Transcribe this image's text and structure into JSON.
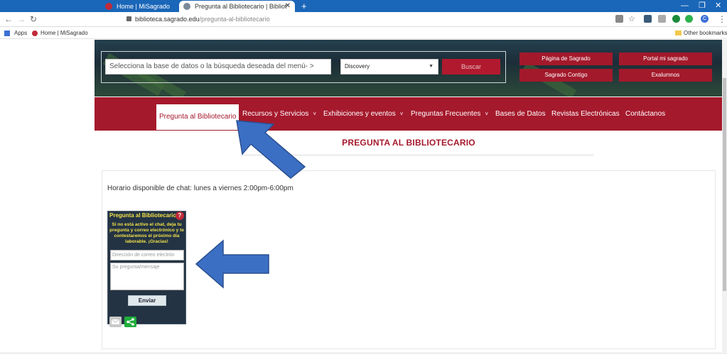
{
  "browser": {
    "tabs": [
      {
        "title": "Home | MiSagrado",
        "active": false
      },
      {
        "title": "Pregunta al Bibliotecario | Bibliot",
        "active": true
      }
    ],
    "new_tab_label": "+",
    "url_host": "biblioteca.sagrado.edu",
    "url_path": "/pregunta-al-bibliotecario",
    "bookmarks": {
      "apps_label": "Apps",
      "home_label": "Home | MiSagrado",
      "other_label": "Other bookmarks"
    },
    "profile_initial": "C"
  },
  "search": {
    "input_placeholder": "Selecciona la base de datos o la búsqueda deseada  del menú- >",
    "select_value": "Discovery",
    "button_label": "Buscar"
  },
  "quick_links": [
    "Página de Sagrado",
    "Portal mi sagrado",
    "Sagrado Contigo",
    "Exalumnos"
  ],
  "nav": {
    "items": [
      {
        "label": "Pregunta al Bibliotecario",
        "has_chevron": false,
        "active": true
      },
      {
        "label": "Recursos y Servicios",
        "has_chevron": true
      },
      {
        "label": "Exhibiciones y eventos",
        "has_chevron": true
      },
      {
        "label": "Preguntas Frecuentes",
        "has_chevron": true
      },
      {
        "label": "Bases de Datos",
        "has_chevron": false
      },
      {
        "label": "Revistas Electrónicas",
        "has_chevron": false
      },
      {
        "label": "Contáctanos",
        "has_chevron": false
      }
    ],
    "chevron": "˅"
  },
  "page": {
    "title": "PREGUNTA AL BIBLIOTECARIO",
    "hours": "Horario disponible de chat: lunes a viernes 2:00pm-6:00pm"
  },
  "widget": {
    "title": "Pregunta al Bibliotecario",
    "help": "?",
    "message": "Si no está activo el chat, deja tu pregunta y correo electrónico y te contestaremos el próximo día laborable. ¡Gracias!",
    "email_placeholder": "Dirección de correo electrón",
    "question_placeholder": "Su pregunta/mensaje",
    "send_label": "Enviar"
  },
  "colors": {
    "brand_red": "#a5192c",
    "tab_blue": "#1a66b8",
    "widget_yellow": "#f2e04a",
    "arrow_blue": "#3b6fc4"
  }
}
